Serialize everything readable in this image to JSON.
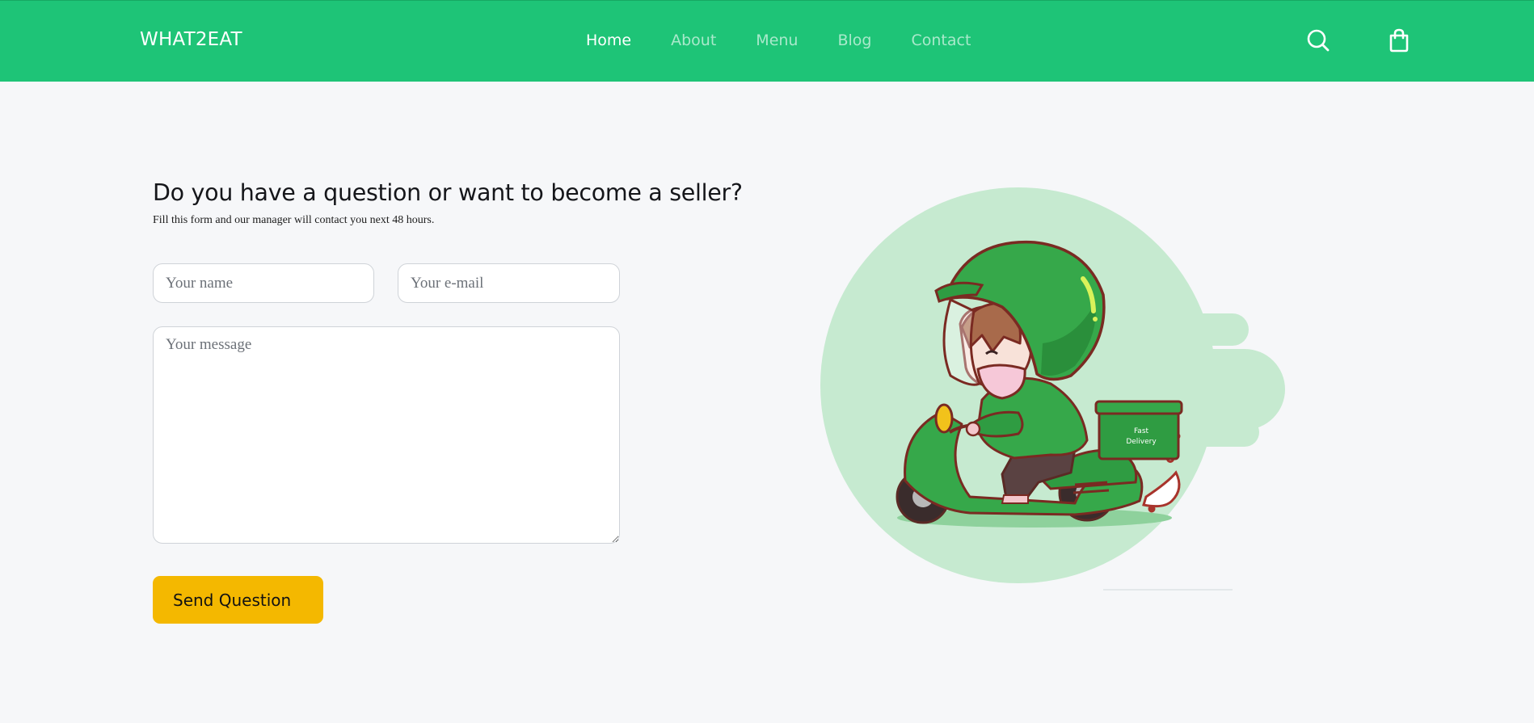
{
  "header": {
    "brand": "WHAT2EAT",
    "nav": [
      {
        "label": "Home",
        "active": true
      },
      {
        "label": "About",
        "active": false
      },
      {
        "label": "Menu",
        "active": false
      },
      {
        "label": "Blog",
        "active": false
      },
      {
        "label": "Contact",
        "active": false
      }
    ],
    "icons": {
      "search": "search-icon",
      "cart": "shopping-bag-icon"
    }
  },
  "contact_form": {
    "title": "Do you have a question or want to become a seller?",
    "subtitle": "Fill this form and our manager will contact you next 48 hours.",
    "name_placeholder": "Your name",
    "email_placeholder": "Your e-mail",
    "message_placeholder": "Your message",
    "name_value": "",
    "email_value": "",
    "message_value": "",
    "submit_label": "Send Question"
  },
  "illustration": {
    "subject": "delivery-courier-on-scooter",
    "box_text_line1": "Fast",
    "box_text_line2": "Delivery"
  },
  "colors": {
    "header_bg": "#1ec477",
    "page_bg": "#f6f7f9",
    "button_bg": "#f4b800",
    "illustration_circle": "#c6ead0"
  }
}
